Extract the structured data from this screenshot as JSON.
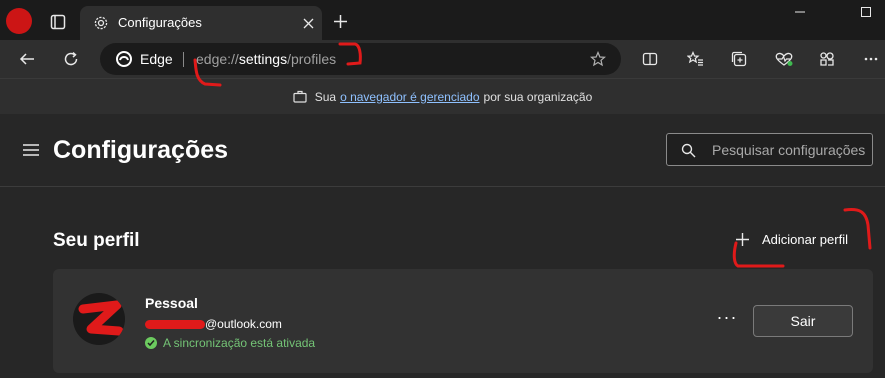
{
  "browser": {
    "tab_title": "Configurações",
    "omnibox_label": "Edge",
    "url": {
      "scheme": "edge://",
      "host": "settings",
      "path": "/profiles"
    },
    "managed_notice": {
      "before": "Sua",
      "link": "o navegador é gerenciado",
      "after": "por sua organização"
    }
  },
  "settings": {
    "title": "Configurações",
    "search_placeholder": "Pesquisar configurações"
  },
  "profile_section": {
    "title": "Seu perfil",
    "add_label": "Adicionar perfil"
  },
  "profile": {
    "name": "Pessoal",
    "email_domain": "@outlook.com",
    "sync_status": "A sincronização está ativada",
    "more_label": "···",
    "signout_label": "Sair"
  },
  "colors": {
    "accent_link": "#8fc1ff",
    "sync_green": "#6ccb5f",
    "redaction": "#e01a1a"
  }
}
